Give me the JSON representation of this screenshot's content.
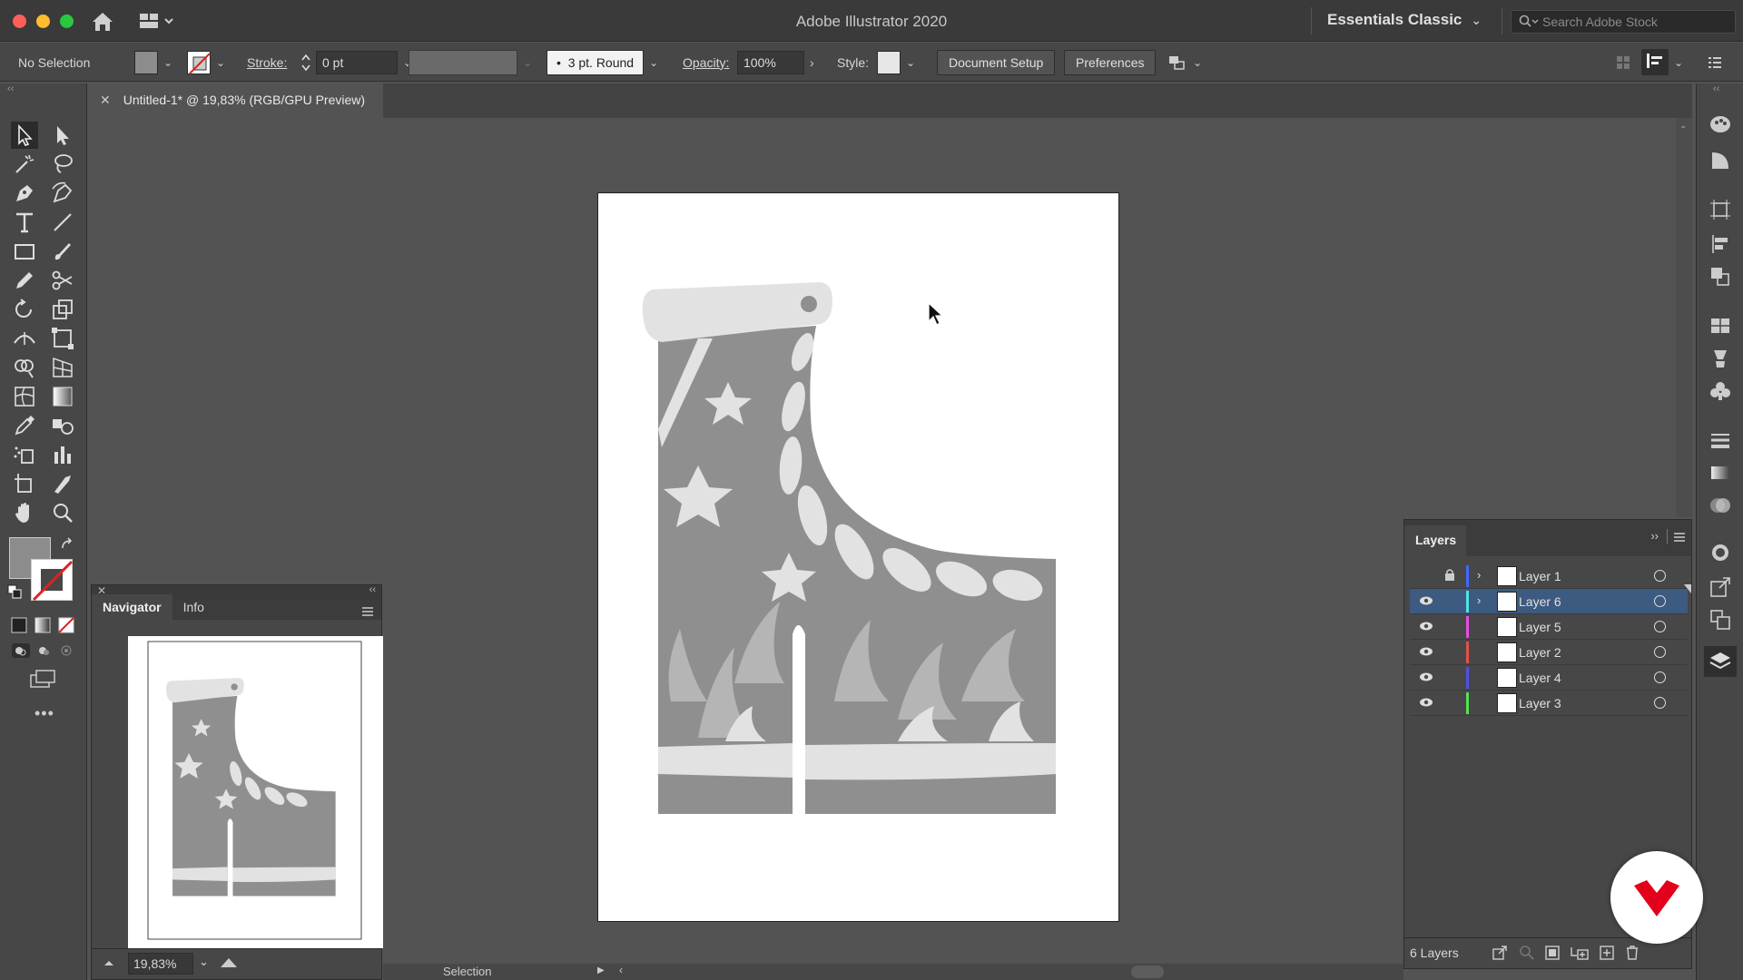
{
  "titlebar": {
    "app_title": "Adobe Illustrator 2020",
    "workspace": "Essentials Classic",
    "search_placeholder": "Search Adobe Stock"
  },
  "control_bar": {
    "selection_status": "No Selection",
    "stroke_label": "Stroke:",
    "stroke_value": "0 pt",
    "brush_label": "3 pt. Round",
    "opacity_label": "Opacity:",
    "opacity_value": "100%",
    "style_label": "Style:",
    "document_setup_label": "Document Setup",
    "preferences_label": "Preferences",
    "fill_color": "#8c8c8c",
    "stroke_color": "#ffffff"
  },
  "document_tab": {
    "title": "Untitled-1* @ 19,83% (RGB/GPU Preview)"
  },
  "navigator": {
    "tabs": [
      "Navigator",
      "Info"
    ],
    "zoom": "19,83%"
  },
  "layers_panel": {
    "title": "Layers",
    "count_label": "6 Layers",
    "layers": [
      {
        "name": "Layer 1",
        "color": "#3d6bff",
        "locked": true,
        "visible": false,
        "expandable": true,
        "selected": false
      },
      {
        "name": "Layer 6",
        "color": "#4fe4e4",
        "locked": false,
        "visible": true,
        "expandable": true,
        "selected": true
      },
      {
        "name": "Layer 5",
        "color": "#e44fe4",
        "locked": false,
        "visible": true,
        "expandable": false,
        "selected": false
      },
      {
        "name": "Layer 2",
        "color": "#e45050",
        "locked": false,
        "visible": true,
        "expandable": false,
        "selected": false
      },
      {
        "name": "Layer 4",
        "color": "#5050e4",
        "locked": false,
        "visible": true,
        "expandable": false,
        "selected": false
      },
      {
        "name": "Layer 3",
        "color": "#50e450",
        "locked": false,
        "visible": true,
        "expandable": false,
        "selected": false
      }
    ]
  },
  "statusbar": {
    "tool": "Selection"
  },
  "artwork": {
    "boot_color": "#8f8f8f",
    "pattern_color": "#b5b5b5",
    "highlight_color": "#e2e2e2"
  }
}
